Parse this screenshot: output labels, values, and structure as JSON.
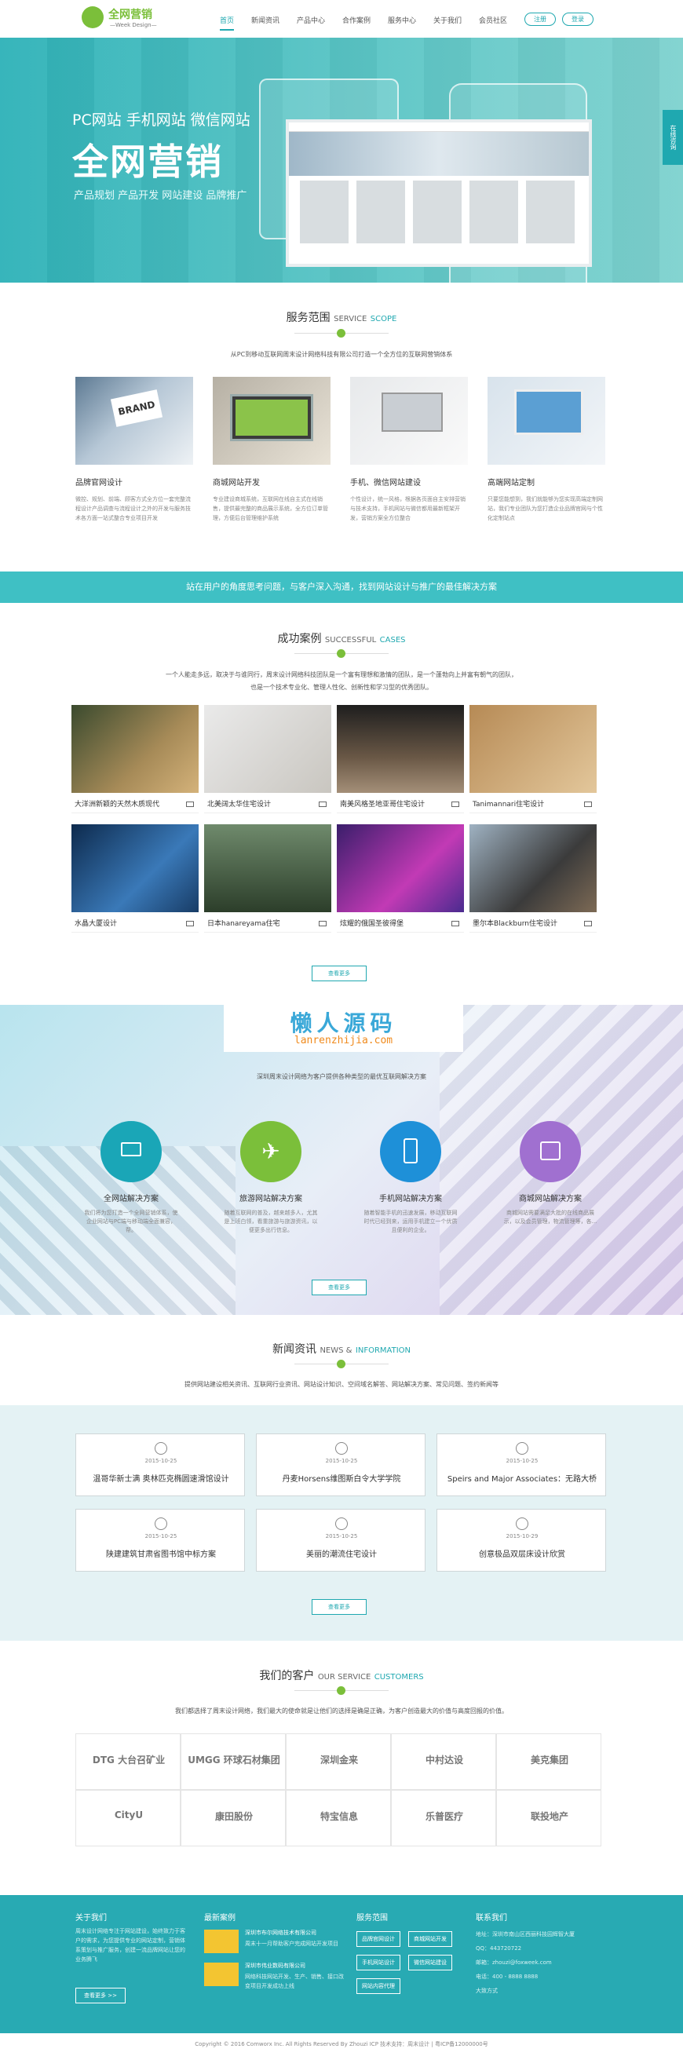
{
  "nav": {
    "logo_title": "全网营销",
    "logo_sub": "—Week Design—",
    "items": [
      "首页",
      "新闻资讯",
      "产品中心",
      "合作案例",
      "服务中心",
      "关于我们",
      "会员社区"
    ],
    "login": "注册",
    "register": "登录"
  },
  "hero": {
    "line1": "PC网站 手机网站 微信网站",
    "line2": "全网营销",
    "line3": "产品规划 产品开发 网站建设 品牌推广",
    "side_tab": "在线咨询"
  },
  "services": {
    "title": "服务范围",
    "title_en1": "SERVICE",
    "title_en2": "SCOPE",
    "subtitle": "从PC到移动互联网周末设计网络科技有限公司打造一个全方位的互联网营销体系",
    "items": [
      {
        "title": "品牌官网设计",
        "desc": "微控、规划、前端、顾客方式全方位一套完整流程设计产品调查与流程设计之外的开发与服务技术各方面一站式整合专业项目开发"
      },
      {
        "title": "商城网站开发",
        "desc": "专业建设商城系统，互联网在线自主式在线销售，提供最完整的商品展示系统，全方位订单管理，方便后台管理维护系统"
      },
      {
        "title": "手机、微信网站建设",
        "desc": "个性设计，统一风格，根据各页面自主安排营销与技术支持，手机网站与微信都用最新框架开发，营销方案全方位整合"
      },
      {
        "title": "高端网站定制",
        "desc": "只要您能想到，我们就能够为您实现高端定制网站，我们专业团队为您打造企业品牌官网与个性化定制站点"
      }
    ]
  },
  "band": "站在用户的角度思考问题，与客户深入沟通，找到网站设计与推广的最佳解决方案",
  "cases": {
    "title": "成功案例",
    "title_en1": "SUCCESSFUL",
    "title_en2": "CASES",
    "subtitle1": "一个人能走多远，取决于与谁同行，周末设计网络科技团队是一个富有理想和激情的团队，是一个蓬勃向上并富有朝气的团队，",
    "subtitle2": "也是一个技术专业化、管理人性化、创新性和学习型的优秀团队。",
    "items": [
      "大洋洲新颖的天然木质现代",
      "北美阔太华住宅设计",
      "南美风格圣地亚哥住宅设计",
      "Tanimannari住宅设计",
      "水晶大厦设计",
      "日本hanareyama住宅",
      "炫耀的俄国圣彼得堡",
      "墨尔本Blackburn住宅设计"
    ],
    "more": "查看更多"
  },
  "watermark": {
    "cn": "懒人源码",
    "en": "lanrenzhijia.com"
  },
  "solutions": {
    "subtitle": "深圳周末设计网络为客户提供各种类型的最优互联网解决方案",
    "items": [
      {
        "title": "全网站解决方案",
        "icon": "monitor-icon",
        "color": "#1aa6b7",
        "desc": "我们将为您打造一个全网营销体系，使企业网站与PC端与移动端全面兼容，帮。"
      },
      {
        "title": "旅游网站解决方案",
        "icon": "airplane-icon",
        "color": "#7bbf3a",
        "desc": "随着互联网的普及，越来越多人，尤其是上班白领，看重旅游与旅游资讯，以便更多出行信息。"
      },
      {
        "title": "手机网站解决方案",
        "icon": "phone-icon",
        "color": "#1e90d8",
        "desc": "随着智能手机的迅速发展，移动互联网时代已经到来，运用手机建立一个优质且便利的企业。"
      },
      {
        "title": "商城网站解决方案",
        "icon": "bag-icon",
        "color": "#a070d0",
        "desc": "商城网站需要满足大批的在线商品展示，以及会员管理，物流管理等，各..."
      }
    ],
    "more": "查看更多"
  },
  "news": {
    "title": "新闻资讯",
    "title_en1": "NEWS &",
    "title_en2": "INFORMATION",
    "subtitle": "提供网站建设相关资讯、互联网行业资讯、网站设计知识、空间域名解答、网站解决方案、常见问题、签约新闻等",
    "items": [
      {
        "date": "2015-10-25",
        "title": "温哥华新士满 奥林匹克椭圆速滑馆设计"
      },
      {
        "date": "2015-10-25",
        "title": "丹麦Horsens维图斯白令大学学院"
      },
      {
        "date": "2015-10-25",
        "title": "Speirs and Major Associates：无路大桥"
      },
      {
        "date": "2015-10-25",
        "title": "陕建建筑甘肃省图书馆中标方案"
      },
      {
        "date": "2015-10-25",
        "title": "美丽的潮流住宅设计"
      },
      {
        "date": "2015-10-29",
        "title": "创意极品双层床设计欣赏"
      }
    ],
    "more": "查看更多"
  },
  "clients": {
    "title": "我们的客户",
    "title_en1": "OUR SERVICE",
    "title_en2": "CUSTOMERS",
    "subtitle": "我们都选择了周末设计网络，我们最大的使命就是让他们的选择是确是正确，为客户创造最大的价值与高度回报的价值。",
    "logos": [
      "DTG 大台召矿业",
      "UMGG 环球石材集团",
      "深圳金来",
      "中村达设",
      "美克集团",
      "CityU",
      "康田股份",
      "特宝信息",
      "乐普医疗",
      "联投地产"
    ]
  },
  "footer": {
    "about_h": "关于我们",
    "about_t": "周末设计网络专注于网站建设，始终致力于客户的需求，为您提供专业的网站定制，营销体系策划与推广服务，创建一流品牌网站让您的业务腾飞",
    "about_btn": "查看更多 >>",
    "cases_h": "最新案例",
    "case1_t": "深圳市布尔网络技术有限公司",
    "case1_d": "周末十一月帮助客户完成网站开发项目",
    "case2_t": "深圳市伟业数码有限公司",
    "case2_d": "网络科技网站开发、生产、销售、接口改变项目开发成功上线",
    "svc_h": "服务范围",
    "svc_btns": [
      "品牌官网设计",
      "商城网站开发",
      "手机网站设计",
      "微信网站建设",
      "网站内容代理"
    ],
    "contact_h": "联系我们",
    "contact": [
      "地址：深圳市南山区西丽科技园辉智大厦",
      "QQ：443720722",
      "邮箱：zhouzi@foxweek.com",
      "电话：400 - 8888 8888",
      "大致方式"
    ]
  },
  "copyright": "Copyright © 2016  Comworx Inc.  All Rights Reserved  By  Zhouzi  ICP  技术支持：周末设计  |  粤ICP备12000000号"
}
